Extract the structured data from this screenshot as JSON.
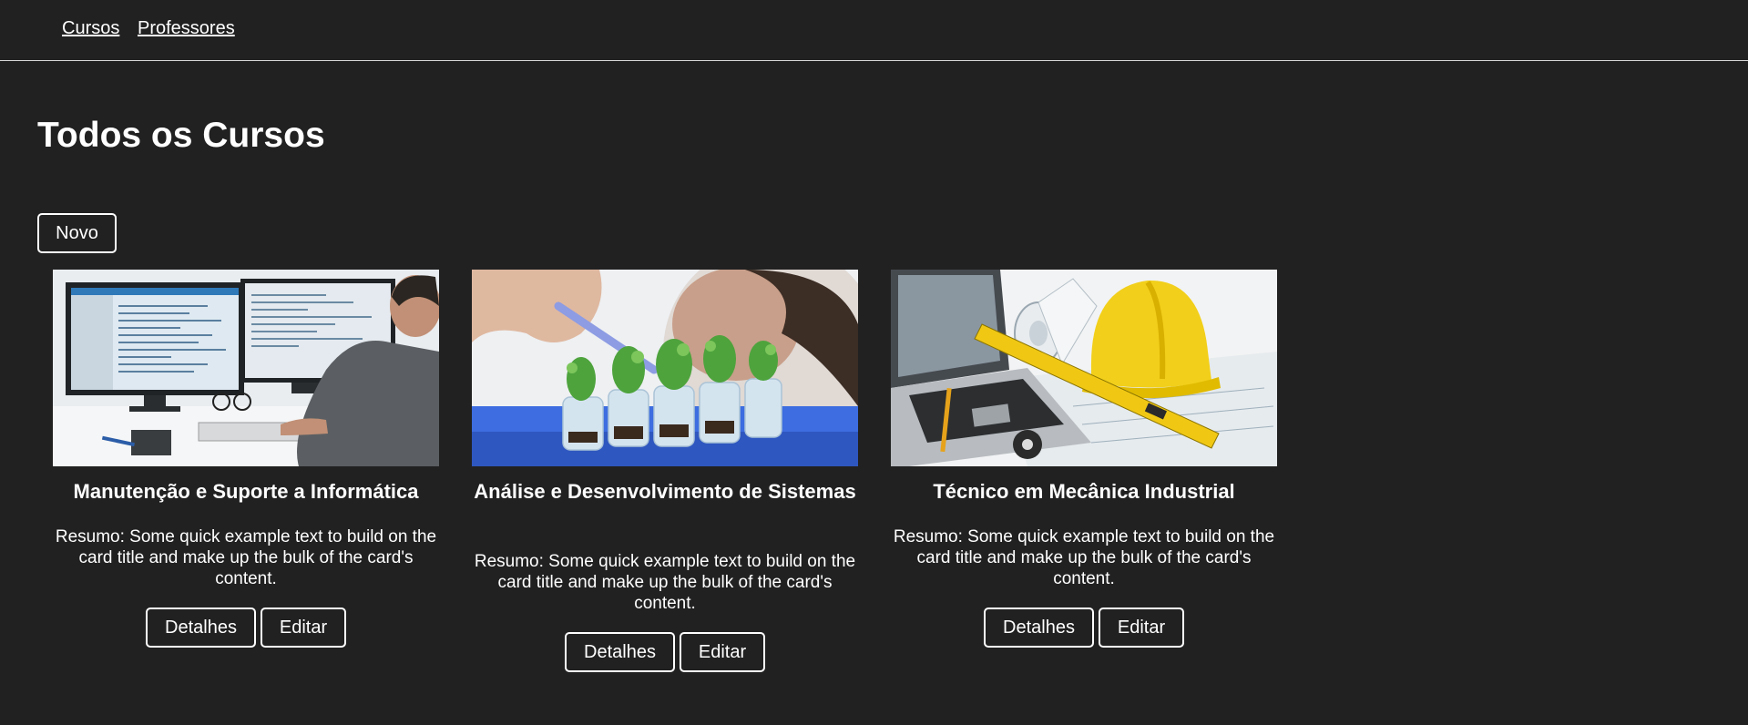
{
  "nav": {
    "items": [
      {
        "label": "Cursos"
      },
      {
        "label": "Professores"
      }
    ]
  },
  "page": {
    "title": "Todos os Cursos",
    "new_button_label": "Novo"
  },
  "courses": [
    {
      "title": "Manutenção e Suporte a Informática",
      "summary": "Resumo: Some quick example text to build on the card title and make up the bulk of the card's content.",
      "details_label": "Detalhes",
      "edit_label": "Editar",
      "image_alt": "Man working at computer with two monitors"
    },
    {
      "title": "Análise e Desenvolvimento de Sistemas",
      "summary": "Resumo: Some quick example text to build on the card title and make up the bulk of the card's content.",
      "details_label": "Detalhes",
      "edit_label": "Editar",
      "image_alt": "Scientist with plant seedlings in test tubes"
    },
    {
      "title": "Técnico em Mecânica Industrial",
      "summary": "Resumo: Some quick example text to build on the card title and make up the bulk of the card's content.",
      "details_label": "Detalhes",
      "edit_label": "Editar",
      "image_alt": "Laptop, blueprints, yellow hard hat and level"
    }
  ],
  "colors": {
    "background": "#212121",
    "text": "#ffffff",
    "border": "#ffffff",
    "hardhat_yellow": "#f2cf1a"
  }
}
